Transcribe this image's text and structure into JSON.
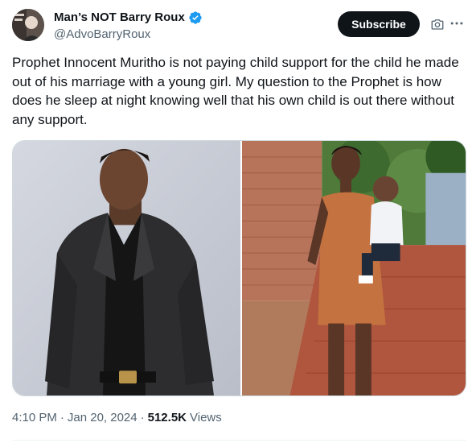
{
  "author": {
    "display_name": "Man’s NOT Barry Roux",
    "handle": "@AdvoBarryRoux",
    "verified": true,
    "avatar_icon": "avatar-photo"
  },
  "actions": {
    "subscribe_label": "Subscribe",
    "camera_icon": "camera-icon",
    "more_icon": "more-options-icon"
  },
  "tweet": {
    "text": "Prophet Innocent Muritho is not paying child support for the child he made out of his marriage with a young girl. My question to the Prophet is how does he sleep at night knowing well that his own child is out there without any support."
  },
  "media": {
    "photos": [
      {
        "description_icon": "photo-man-in-suit"
      },
      {
        "description_icon": "photo-woman-with-child"
      }
    ]
  },
  "meta": {
    "time": "4:10 PM",
    "separator": "·",
    "date": "Jan 20, 2024",
    "views_count": "512.5K",
    "views_label": "Views"
  },
  "colors": {
    "text_primary": "#0f1419",
    "text_secondary": "#536471",
    "verified_blue": "#1d9bf0",
    "subscribe_bg": "#0f1419"
  }
}
